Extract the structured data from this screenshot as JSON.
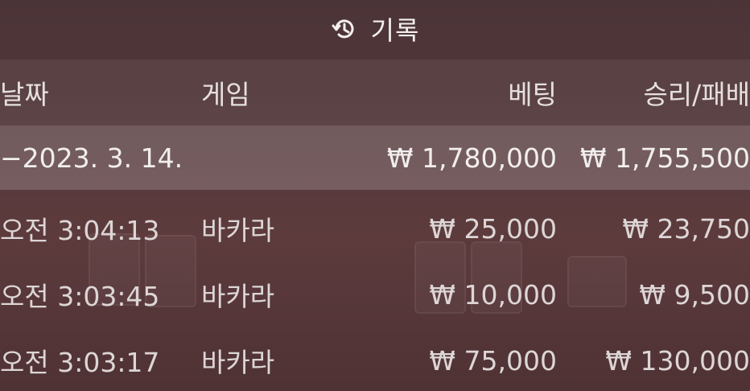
{
  "header": {
    "icon": "history-icon",
    "title": "기록"
  },
  "table": {
    "columns": {
      "date": "날짜",
      "game": "게임",
      "bet": "베팅",
      "result": "승리/패배"
    },
    "date_group": {
      "date": "−2023. 3. 14.",
      "bet_total": "₩ 1,780,000",
      "result_total": "₩ 1,755,500"
    },
    "rows": [
      {
        "time": "오전 3:04:13",
        "game": "바카라",
        "bet": "₩ 25,000",
        "result": "₩ 23,750"
      },
      {
        "time": "오전 3:03:45",
        "game": "바카라",
        "bet": "₩ 10,000",
        "result": "₩ 9,500"
      },
      {
        "time": "오전 3:03:17",
        "game": "바카라",
        "bet": "₩ 75,000",
        "result": "₩ 130,000"
      }
    ]
  },
  "colors": {
    "background": "#52383a",
    "text": "#e9e4e4",
    "date_group_highlight": "#7a6264"
  }
}
